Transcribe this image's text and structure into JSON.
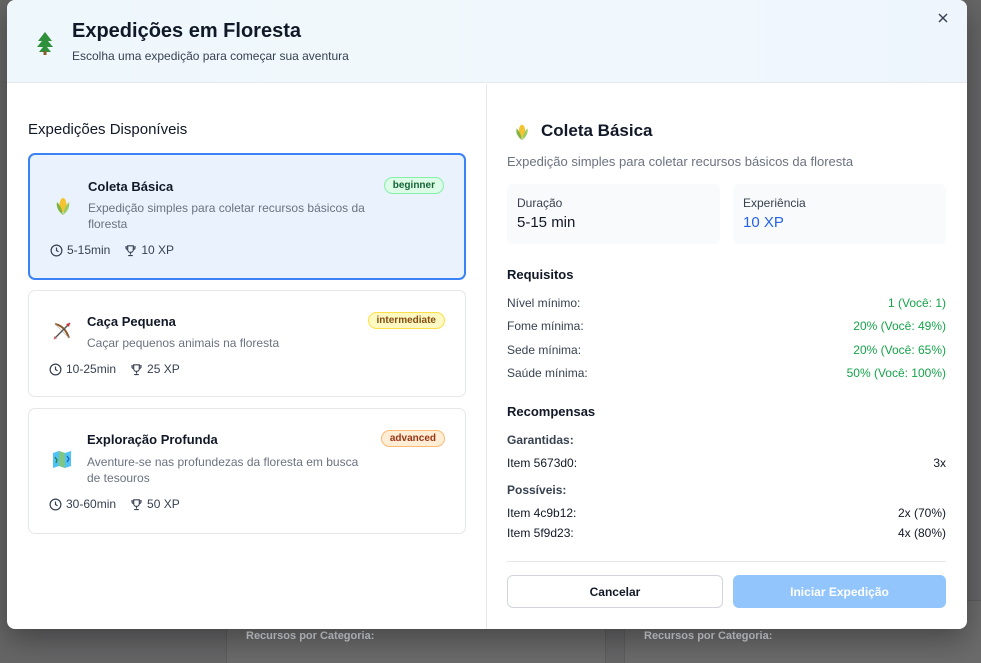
{
  "background": {
    "left_section_label": "Recursos por Categoria:",
    "right_section_label": "Recursos por Categoria:"
  },
  "header": {
    "title": "Expedições em Floresta",
    "subtitle": "Escolha uma expedição para começar sua aventura",
    "icon": "pine-tree-icon"
  },
  "list": {
    "title": "Expedições Disponíveis",
    "items": [
      {
        "name": "Coleta Básica",
        "description": "Expedição simples para coletar recursos básicos da floresta",
        "difficulty": "beginner",
        "duration": "5-15min",
        "xp": "10 XP",
        "icon": "corn-icon",
        "selected": true
      },
      {
        "name": "Caça Pequena",
        "description": "Caçar pequenos animais na floresta",
        "difficulty": "intermediate",
        "duration": "10-25min",
        "xp": "25 XP",
        "icon": "bow-arrow-icon",
        "selected": false
      },
      {
        "name": "Exploração Profunda",
        "description": "Aventure-se nas profundezas da floresta em busca de tesouros",
        "difficulty": "advanced",
        "duration": "30-60min",
        "xp": "50 XP",
        "icon": "map-icon",
        "selected": false
      }
    ]
  },
  "detail": {
    "title": "Coleta Básica",
    "description": "Expedição simples para coletar recursos básicos da floresta",
    "duration_label": "Duração",
    "duration_value": "5-15 min",
    "xp_label": "Experiência",
    "xp_value": "10 XP",
    "requirements_title": "Requisitos",
    "requirements": [
      {
        "label": "Nível mínimo:",
        "value": "1 (Você: 1)"
      },
      {
        "label": "Fome mínima:",
        "value": "20% (Você: 49%)"
      },
      {
        "label": "Sede mínima:",
        "value": "20% (Você: 65%)"
      },
      {
        "label": "Saúde mínima:",
        "value": "50% (Você: 100%)"
      }
    ],
    "rewards_title": "Recompensas",
    "guaranteed_label": "Garantidas:",
    "guaranteed": [
      {
        "item": "Item 5673d0:",
        "qty": "3x"
      }
    ],
    "possible_label": "Possíveis:",
    "possible": [
      {
        "item": "Item 4c9b12:",
        "qty": "2x (70%)"
      },
      {
        "item": "Item 5f9d23:",
        "qty": "4x (80%)"
      }
    ],
    "success_color": "#16a34a",
    "accent_color": "#2563eb"
  },
  "actions": {
    "cancel": "Cancelar",
    "start": "Iniciar Expedição"
  }
}
